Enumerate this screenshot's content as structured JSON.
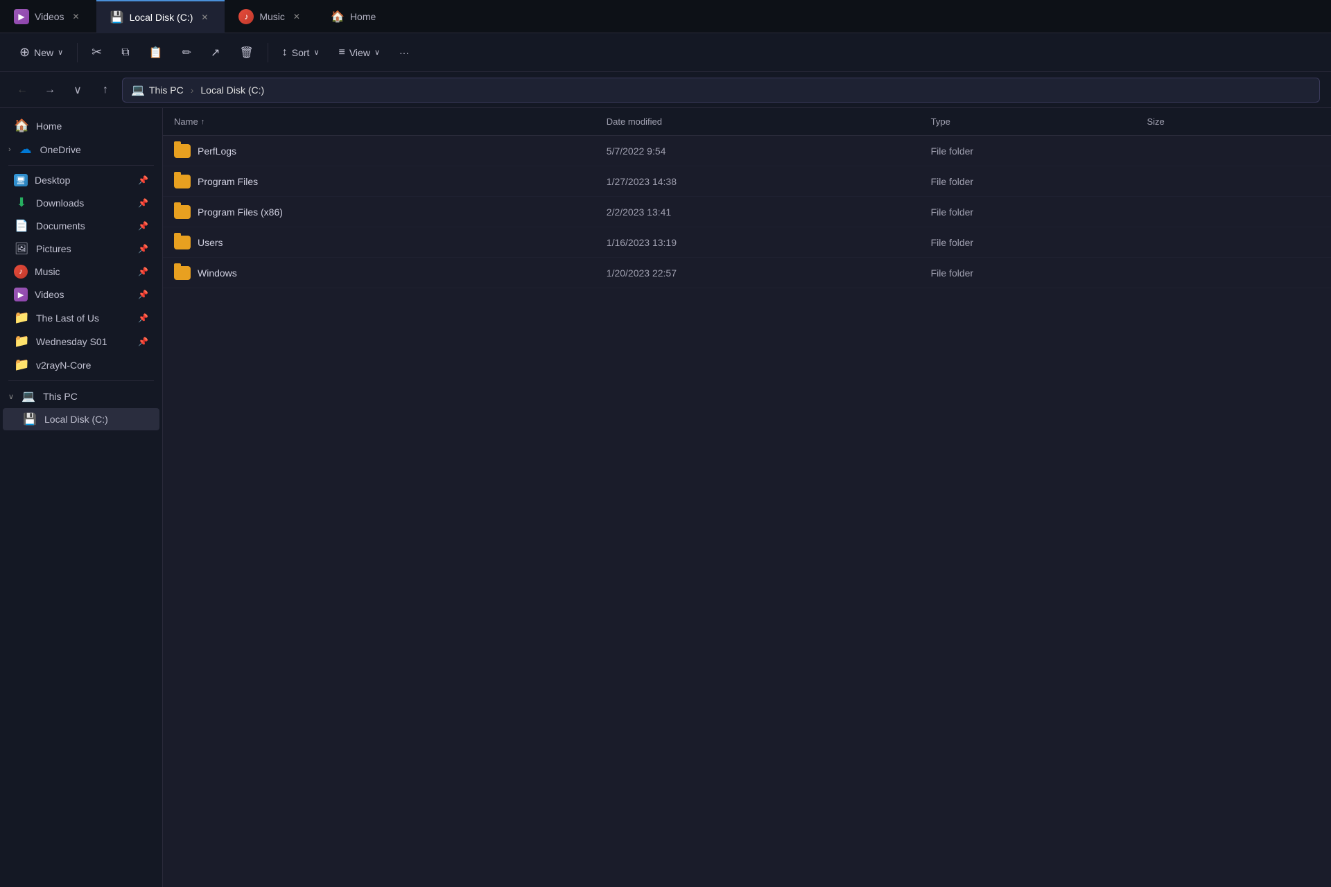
{
  "titlebar": {
    "tabs": [
      {
        "id": "videos",
        "label": "Videos",
        "icon": "🎬",
        "active": false,
        "color": "#9b59b6"
      },
      {
        "id": "local-disk",
        "label": "Local Disk (C:)",
        "icon": "💾",
        "active": true,
        "color": "#4a90d9"
      },
      {
        "id": "music",
        "label": "Music",
        "icon": "🎵",
        "active": false,
        "color": "#e74c3c"
      },
      {
        "id": "home",
        "label": "Home",
        "icon": "🏠",
        "active": false,
        "color": "#e67e22"
      }
    ]
  },
  "toolbar": {
    "new_label": "New",
    "sort_label": "Sort",
    "view_label": "View",
    "more_label": "···",
    "cut_icon": "✂",
    "copy_icon": "⧉",
    "paste_icon": "📋",
    "rename_icon": "✏",
    "share_icon": "↗",
    "delete_icon": "🗑"
  },
  "addressbar": {
    "this_pc": "This PC",
    "local_disk": "Local Disk (C:)",
    "separator": "›"
  },
  "sidebar": {
    "home_label": "Home",
    "onedrive_label": "OneDrive",
    "desktop_label": "Desktop",
    "downloads_label": "Downloads",
    "documents_label": "Documents",
    "pictures_label": "Pictures",
    "music_label": "Music",
    "videos_label": "Videos",
    "the_last_of_us_label": "The Last of Us",
    "wednesday_s01_label": "Wednesday S01",
    "v2rayn_core_label": "v2rayN-Core",
    "this_pc_label": "This PC",
    "local_disk_label": "Local Disk (C:)"
  },
  "file_list": {
    "columns": {
      "name": "Name",
      "date_modified": "Date modified",
      "type": "Type",
      "size": "Size"
    },
    "rows": [
      {
        "name": "PerfLogs",
        "date": "5/7/2022 9:54",
        "type": "File folder",
        "size": ""
      },
      {
        "name": "Program Files",
        "date": "1/27/2023 14:38",
        "type": "File folder",
        "size": ""
      },
      {
        "name": "Program Files (x86)",
        "date": "2/2/2023 13:41",
        "type": "File folder",
        "size": ""
      },
      {
        "name": "Users",
        "date": "1/16/2023 13:19",
        "type": "File folder",
        "size": ""
      },
      {
        "name": "Windows",
        "date": "1/20/2023 22:57",
        "type": "File folder",
        "size": ""
      }
    ]
  },
  "icons": {
    "new": "+",
    "cut": "✂",
    "copy": "⧉",
    "paste": "📋",
    "rename": "✏",
    "share": "↗",
    "delete": "🗑",
    "sort": "↕",
    "view": "≡",
    "more": "···",
    "back": "←",
    "forward": "→",
    "down": "∨",
    "up": "↑",
    "home": "🏠",
    "onedrive": "☁",
    "desktop": "🖥",
    "downloads": "⬇",
    "documents": "📄",
    "pictures": "🖼",
    "music": "🎵",
    "videos": "🎬",
    "folder": "📁",
    "pin": "📌",
    "this_pc": "💻",
    "sort_asc": "↑"
  }
}
